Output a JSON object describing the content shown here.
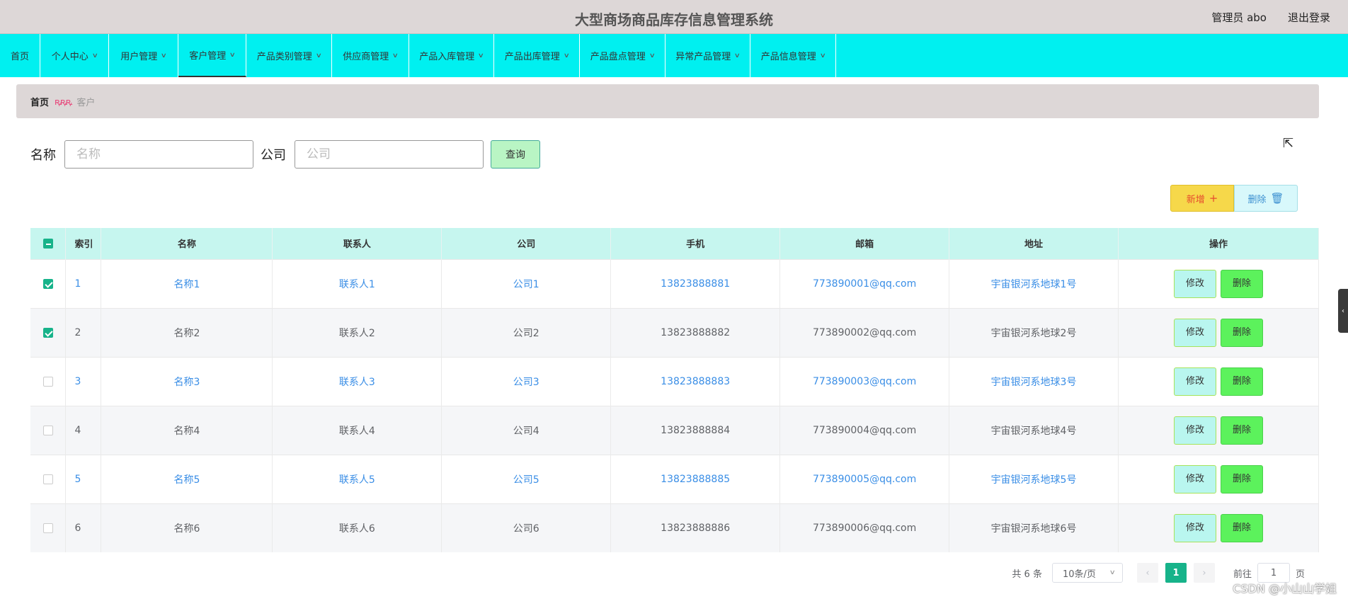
{
  "header": {
    "title": "大型商场商品库存信息管理系统",
    "admin_label": "管理员 abo",
    "logout_label": "退出登录"
  },
  "nav": {
    "items": [
      {
        "label": "首页"
      },
      {
        "label": "个人中心"
      },
      {
        "label": "用户管理"
      },
      {
        "label": "客户管理",
        "active": true
      },
      {
        "label": "产品类别管理"
      },
      {
        "label": "供应商管理"
      },
      {
        "label": "产品入库管理"
      },
      {
        "label": "产品出库管理"
      },
      {
        "label": "产品盘点管理"
      },
      {
        "label": "异常产品管理"
      },
      {
        "label": "产品信息管理"
      }
    ]
  },
  "breadcrumb": {
    "home": "首页",
    "separator": "ꝶꝶꝶ",
    "current": "客户"
  },
  "search": {
    "name_label": "名称",
    "name_placeholder": "名称",
    "company_label": "公司",
    "company_placeholder": "公司",
    "query_label": "查询"
  },
  "actions": {
    "add_label": "新增",
    "add_icon": "+",
    "delete_label": "删除",
    "delete_icon": "🗑"
  },
  "table": {
    "headers": [
      "索引",
      "名称",
      "联系人",
      "公司",
      "手机",
      "邮箱",
      "地址",
      "操作"
    ],
    "rows": [
      {
        "index": "1",
        "name": "名称1",
        "contact": "联系人1",
        "company": "公司1",
        "phone": "13823888881",
        "email": "773890001@qq.com",
        "address": "宇宙银河系地球1号",
        "checked": true
      },
      {
        "index": "2",
        "name": "名称2",
        "contact": "联系人2",
        "company": "公司2",
        "phone": "13823888882",
        "email": "773890002@qq.com",
        "address": "宇宙银河系地球2号",
        "checked": true
      },
      {
        "index": "3",
        "name": "名称3",
        "contact": "联系人3",
        "company": "公司3",
        "phone": "13823888883",
        "email": "773890003@qq.com",
        "address": "宇宙银河系地球3号",
        "checked": false
      },
      {
        "index": "4",
        "name": "名称4",
        "contact": "联系人4",
        "company": "公司4",
        "phone": "13823888884",
        "email": "773890004@qq.com",
        "address": "宇宙银河系地球4号",
        "checked": false
      },
      {
        "index": "5",
        "name": "名称5",
        "contact": "联系人5",
        "company": "公司5",
        "phone": "13823888885",
        "email": "773890005@qq.com",
        "address": "宇宙银河系地球5号",
        "checked": false
      },
      {
        "index": "6",
        "name": "名称6",
        "contact": "联系人6",
        "company": "公司6",
        "phone": "13823888886",
        "email": "773890006@qq.com",
        "address": "宇宙银河系地球6号",
        "checked": false
      }
    ],
    "edit_label": "修改",
    "delete_label": "删除"
  },
  "pagination": {
    "total_label": "共 6 条",
    "page_size_label": "10条/页",
    "prev_icon": "‹",
    "next_icon": "›",
    "current_page": "1",
    "goto_label": "前往",
    "goto_value": "1",
    "page_suffix": "页"
  },
  "watermark": "CSDN @小山山学姐",
  "colors": {
    "nav_bg": "#00f0f0",
    "header_bg": "#ddd7d7",
    "table_header_bg": "#c6f6ef",
    "link_blue": "#3a8ee6",
    "primary_green": "#17b38a"
  }
}
